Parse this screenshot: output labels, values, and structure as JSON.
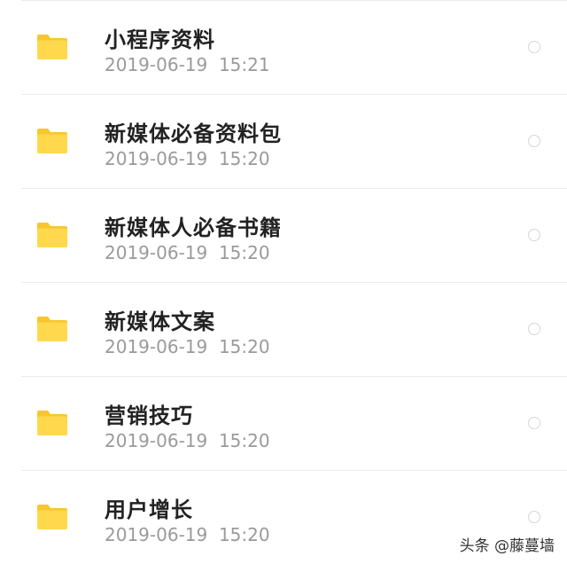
{
  "files": [
    {
      "name": "小程序资料",
      "date": "2019-06-19  15:21"
    },
    {
      "name": "新媒体必备资料包",
      "date": "2019-06-19  15:20"
    },
    {
      "name": "新媒体人必备书籍",
      "date": "2019-06-19  15:20"
    },
    {
      "name": "新媒体文案",
      "date": "2019-06-19  15:20"
    },
    {
      "name": "营销技巧",
      "date": "2019-06-19  15:20"
    },
    {
      "name": "用户增长",
      "date": "2019-06-19  15:20"
    }
  ],
  "icons": {
    "folder": "folder-icon",
    "select": "radio-unchecked-icon"
  },
  "colors": {
    "folder_body": "#FFD84D",
    "folder_tab": "#F7C62F",
    "title_text": "#222222",
    "date_text": "#9A9A9A",
    "divider": "#ECECEC",
    "radio_border": "#D6D6D6"
  },
  "watermark": "头条 @藤蔓墙"
}
